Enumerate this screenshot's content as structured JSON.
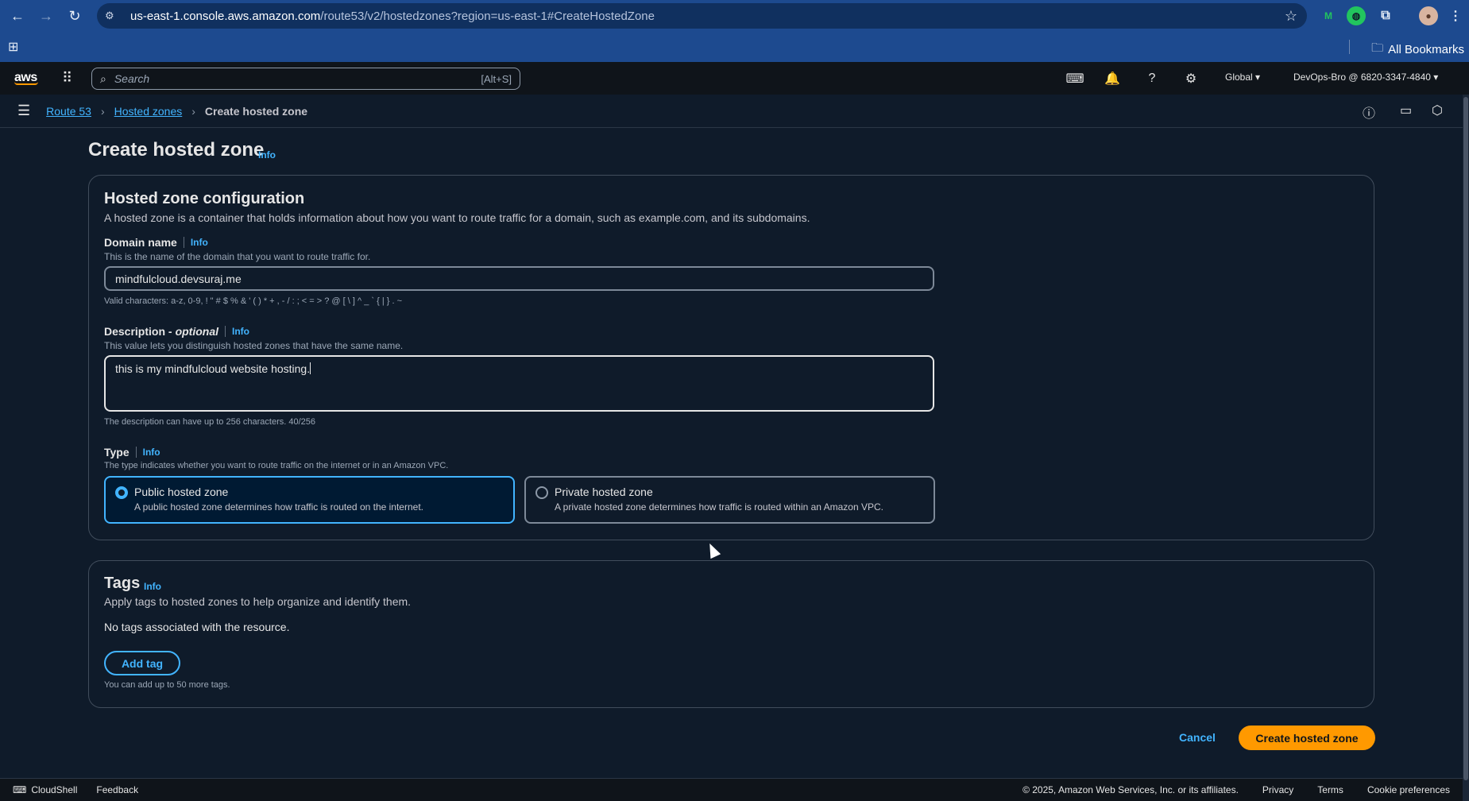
{
  "browser": {
    "url_host": "us-east-1.console.aws.amazon.com",
    "url_path": "/route53/v2/hostedzones?region=us-east-1#CreateHostedZone",
    "all_bookmarks": "All Bookmarks"
  },
  "awsnav": {
    "logo": "aws",
    "search_placeholder": "Search",
    "search_shortcut": "[Alt+S]",
    "region": "Global ▾",
    "account": "DevOps-Bro @ 6820-3347-4840 ▾"
  },
  "breadcrumb": {
    "items": [
      "Route 53",
      "Hosted zones"
    ],
    "current": "Create hosted zone"
  },
  "page": {
    "title": "Create hosted zone",
    "title_info": "Info"
  },
  "config": {
    "heading": "Hosted zone configuration",
    "description": "A hosted zone is a container that holds information about how you want to route traffic for a domain, such as example.com, and its subdomains.",
    "domain": {
      "label": "Domain name",
      "info": "Info",
      "hint": "This is the name of the domain that you want to route traffic for.",
      "value": "mindfulcloud.devsuraj.me",
      "valid_chars": "Valid characters: a-z, 0-9, ! \" # $ % & ' ( ) * + , - / : ; < = > ? @ [ \\ ] ^ _ ` { | } . ~"
    },
    "description_field": {
      "label": "Description -",
      "optional": "optional",
      "info": "Info",
      "hint": "This value lets you distinguish hosted zones that have the same name.",
      "value": "this is my mindfulcloud website hosting.",
      "counter": "The description can have up to 256 characters. 40/256"
    },
    "type": {
      "label": "Type",
      "info": "Info",
      "hint": "The type indicates whether you want to route traffic on the internet or in an Amazon VPC.",
      "options": [
        {
          "title": "Public hosted zone",
          "desc": "A public hosted zone determines how traffic is routed on the internet.",
          "selected": true
        },
        {
          "title": "Private hosted zone",
          "desc": "A private hosted zone determines how traffic is routed within an Amazon VPC.",
          "selected": false
        }
      ]
    }
  },
  "tags": {
    "heading": "Tags",
    "info": "Info",
    "description": "Apply tags to hosted zones to help organize and identify them.",
    "empty": "No tags associated with the resource.",
    "add_button": "Add tag",
    "limit": "You can add up to 50 more tags."
  },
  "actions": {
    "cancel": "Cancel",
    "create": "Create hosted zone"
  },
  "footer": {
    "cloudshell": "CloudShell",
    "feedback": "Feedback",
    "copyright": "© 2025, Amazon Web Services, Inc. or its affiliates.",
    "privacy": "Privacy",
    "terms": "Terms",
    "cookies": "Cookie preferences"
  },
  "colors": {
    "accent": "#42b4ff",
    "primary_button": "#ff9900",
    "background": "#0f1b2a"
  }
}
